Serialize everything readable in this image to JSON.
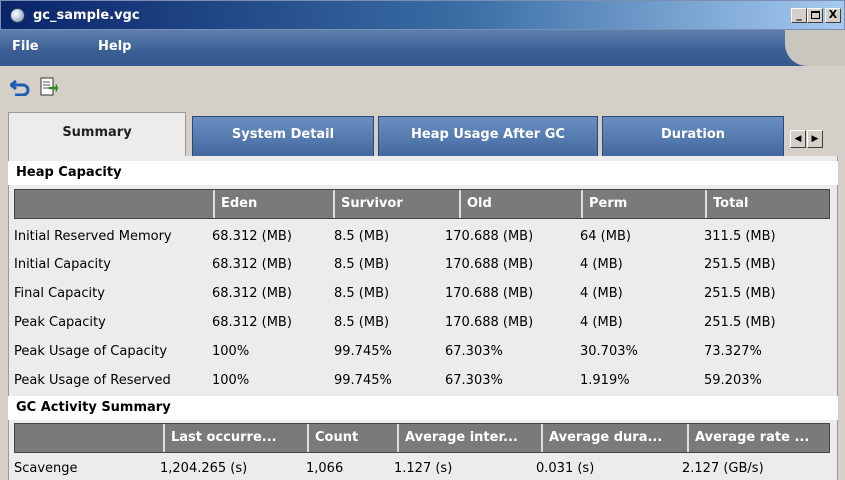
{
  "window": {
    "title": "gc_sample.vgc",
    "min_label": "_",
    "max_label": "□",
    "close_label": "X"
  },
  "menu": {
    "file": "File",
    "help": "Help"
  },
  "toolbar": {
    "back_icon": "undo-arrow-icon",
    "doc_icon": "document-export-icon"
  },
  "tabs": [
    {
      "label": "Summary",
      "active": true
    },
    {
      "label": "System Detail",
      "active": false
    },
    {
      "label": "Heap Usage After GC",
      "active": false
    },
    {
      "label": "Duration",
      "active": false
    }
  ],
  "tab_scroll": {
    "left": "◀",
    "right": "▶"
  },
  "heap_capacity": {
    "title": "Heap Capacity",
    "headers": [
      "",
      "Eden",
      "Survivor",
      "Old",
      "Perm",
      "Total"
    ],
    "rows": [
      [
        "Initial Reserved Memory",
        "68.312 (MB)",
        "8.5 (MB)",
        "170.688 (MB)",
        "64 (MB)",
        "311.5 (MB)"
      ],
      [
        "Initial Capacity",
        "68.312 (MB)",
        "8.5 (MB)",
        "170.688 (MB)",
        "4 (MB)",
        "251.5 (MB)"
      ],
      [
        "Final Capacity",
        "68.312 (MB)",
        "8.5 (MB)",
        "170.688 (MB)",
        "4 (MB)",
        "251.5 (MB)"
      ],
      [
        "Peak Capacity",
        "68.312 (MB)",
        "8.5 (MB)",
        "170.688 (MB)",
        "4 (MB)",
        "251.5 (MB)"
      ],
      [
        "Peak Usage of Capacity",
        "100%",
        "99.745%",
        "67.303%",
        "30.703%",
        "73.327%"
      ],
      [
        "Peak Usage of Reserved",
        "100%",
        "99.745%",
        "67.303%",
        "1.919%",
        "59.203%"
      ]
    ]
  },
  "gc_activity": {
    "title": "GC Activity Summary",
    "headers": [
      "",
      "Last occurre...",
      "Count",
      "Average inter...",
      "Average dura...",
      "Average rate ..."
    ],
    "rows": [
      [
        "Scavenge",
        "1,204.265 (s)",
        "1,066",
        "1.127 (s)",
        "0.031 (s)",
        "2.127 (GB/s)"
      ]
    ]
  },
  "colors": {
    "title_start": "#0a246a",
    "menubar": "#3b5f94",
    "tab": "#42699f",
    "header": "#7a7a7a"
  }
}
